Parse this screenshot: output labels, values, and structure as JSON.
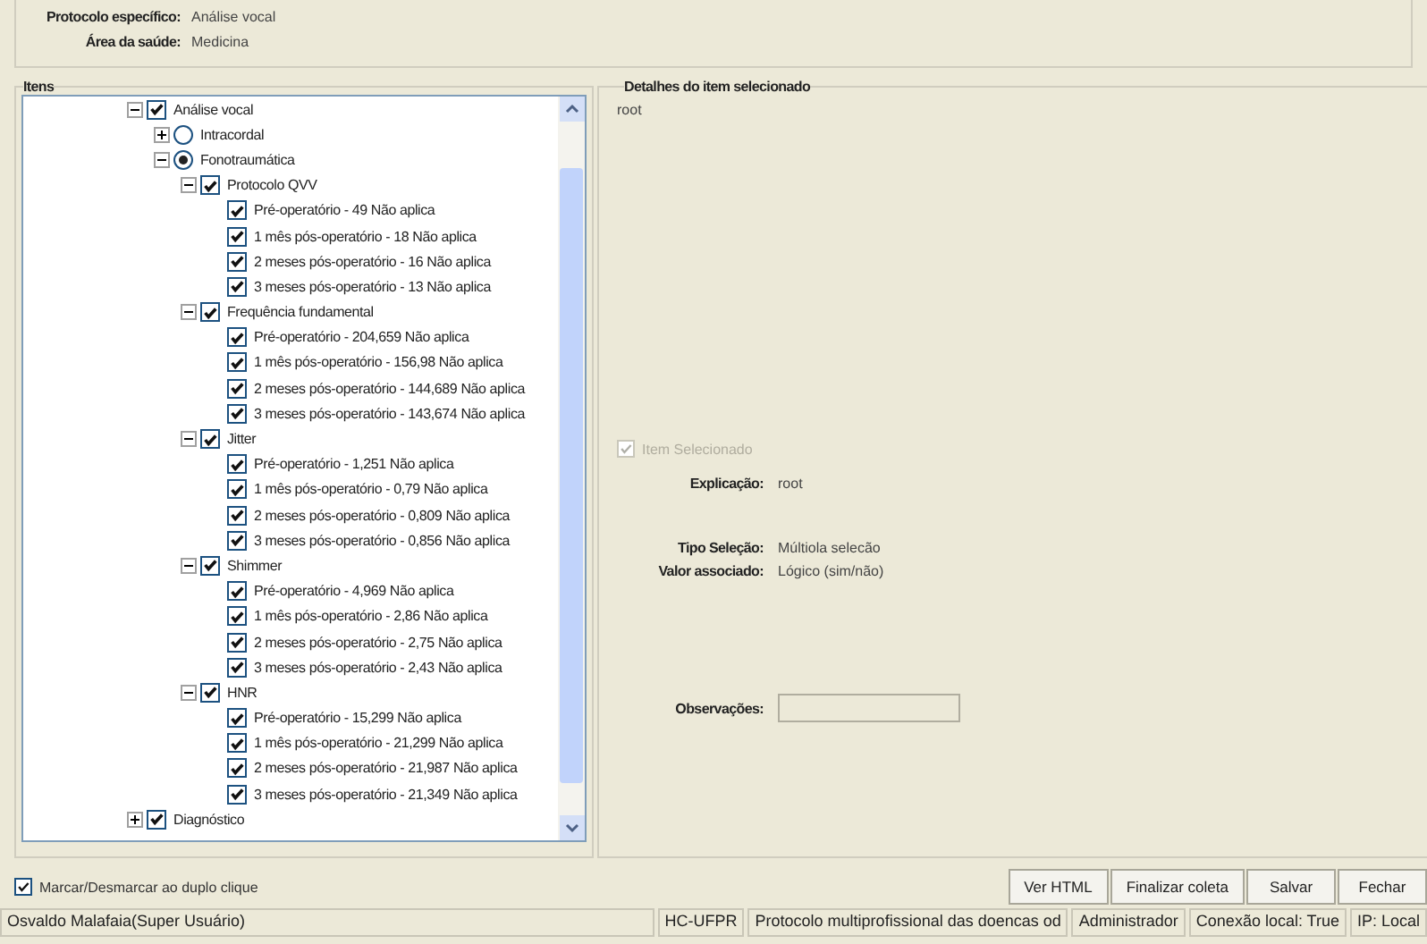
{
  "header": {
    "fields": [
      {
        "label": "Protocolo específico:",
        "value": "Análise vocal"
      },
      {
        "label": "Área da saúde:",
        "value": "Medicina"
      }
    ]
  },
  "items_panel": {
    "title": "Itens",
    "tree": [
      {
        "label": "Análise vocal",
        "kind": "checkbox",
        "checked": true,
        "expanded": true,
        "children": [
          {
            "label": "Intracordal",
            "kind": "radio",
            "selected": false,
            "expanded": false
          },
          {
            "label": "Fonotraumática",
            "kind": "radio",
            "selected": true,
            "expanded": true,
            "children": [
              {
                "label": "Protocolo QVV",
                "kind": "checkbox",
                "checked": true,
                "expanded": true,
                "children": [
                  {
                    "label": "Pré-operatório - 49 Não aplica",
                    "kind": "checkbox",
                    "checked": true
                  },
                  {
                    "label": "1 mês pós-operatório - 18 Não aplica",
                    "kind": "checkbox",
                    "checked": true
                  },
                  {
                    "label": "2 meses  pós-operatório - 16 Não aplica",
                    "kind": "checkbox",
                    "checked": true
                  },
                  {
                    "label": "3 meses  pós-operatório - 13 Não aplica",
                    "kind": "checkbox",
                    "checked": true
                  }
                ]
              },
              {
                "label": "Frequência fundamental",
                "kind": "checkbox",
                "checked": true,
                "expanded": true,
                "children": [
                  {
                    "label": "Pré-operatório - 204,659 Não aplica",
                    "kind": "checkbox",
                    "checked": true
                  },
                  {
                    "label": "1 mês pós-operatório - 156,98 Não aplica",
                    "kind": "checkbox",
                    "checked": true
                  },
                  {
                    "label": "2 meses  pós-operatório - 144,689 Não aplica",
                    "kind": "checkbox",
                    "checked": true
                  },
                  {
                    "label": "3 meses  pós-operatório - 143,674 Não aplica",
                    "kind": "checkbox",
                    "checked": true
                  }
                ]
              },
              {
                "label": "Jitter",
                "kind": "checkbox",
                "checked": true,
                "expanded": true,
                "children": [
                  {
                    "label": "Pré-operatório - 1,251 Não aplica",
                    "kind": "checkbox",
                    "checked": true
                  },
                  {
                    "label": "1 mês pós-operatório - 0,79 Não aplica",
                    "kind": "checkbox",
                    "checked": true
                  },
                  {
                    "label": "2 meses  pós-operatório - 0,809 Não aplica",
                    "kind": "checkbox",
                    "checked": true
                  },
                  {
                    "label": "3 meses  pós-operatório - 0,856 Não aplica",
                    "kind": "checkbox",
                    "checked": true
                  }
                ]
              },
              {
                "label": "Shimmer",
                "kind": "checkbox",
                "checked": true,
                "expanded": true,
                "children": [
                  {
                    "label": "Pré-operatório - 4,969 Não aplica",
                    "kind": "checkbox",
                    "checked": true
                  },
                  {
                    "label": "1 mês pós-operatório - 2,86 Não aplica",
                    "kind": "checkbox",
                    "checked": true
                  },
                  {
                    "label": "2 meses  pós-operatório - 2,75 Não aplica",
                    "kind": "checkbox",
                    "checked": true
                  },
                  {
                    "label": "3 meses  pós-operatório - 2,43 Não aplica",
                    "kind": "checkbox",
                    "checked": true
                  }
                ]
              },
              {
                "label": "HNR",
                "kind": "checkbox",
                "checked": true,
                "expanded": true,
                "children": [
                  {
                    "label": "Pré-operatório - 15,299 Não aplica",
                    "kind": "checkbox",
                    "checked": true
                  },
                  {
                    "label": "1 mês pós-operatório - 21,299 Não aplica",
                    "kind": "checkbox",
                    "checked": true
                  },
                  {
                    "label": "2 meses  pós-operatório - 21,987 Não aplica",
                    "kind": "checkbox",
                    "checked": true
                  },
                  {
                    "label": "3 meses  pós-operatório - 21,349 Não aplica",
                    "kind": "checkbox",
                    "checked": true
                  }
                ]
              }
            ]
          }
        ]
      },
      {
        "label": "Diagnóstico",
        "kind": "checkbox",
        "checked": true,
        "expanded": false
      }
    ],
    "toggle": {
      "label": "Marcar/Desmarcar ao duplo clique",
      "checked": true
    }
  },
  "details": {
    "title": "Detalhes do item selecionado",
    "path": "root",
    "item_selected": {
      "label": "Item Selecionado",
      "checked": true,
      "disabled": true
    },
    "fields": [
      {
        "label": "Explicação:",
        "value": "root"
      },
      {
        "label": "Tipo Seleção:",
        "value": "Múltiola selecão"
      },
      {
        "label": "Valor associado:",
        "value": "Lógico (sim/não)"
      }
    ],
    "notes": {
      "label": "Observações:"
    }
  },
  "buttons": [
    "Ver HTML",
    "Finalizar coleta",
    "Salvar",
    "Fechar"
  ],
  "status_bar": [
    "Osvaldo Malafaia(Super Usuário)",
    "HC-UFPR",
    "Protocolo multiprofissional das doencas od",
    "Administrador",
    "Conexão local: True",
    "IP: Local"
  ]
}
